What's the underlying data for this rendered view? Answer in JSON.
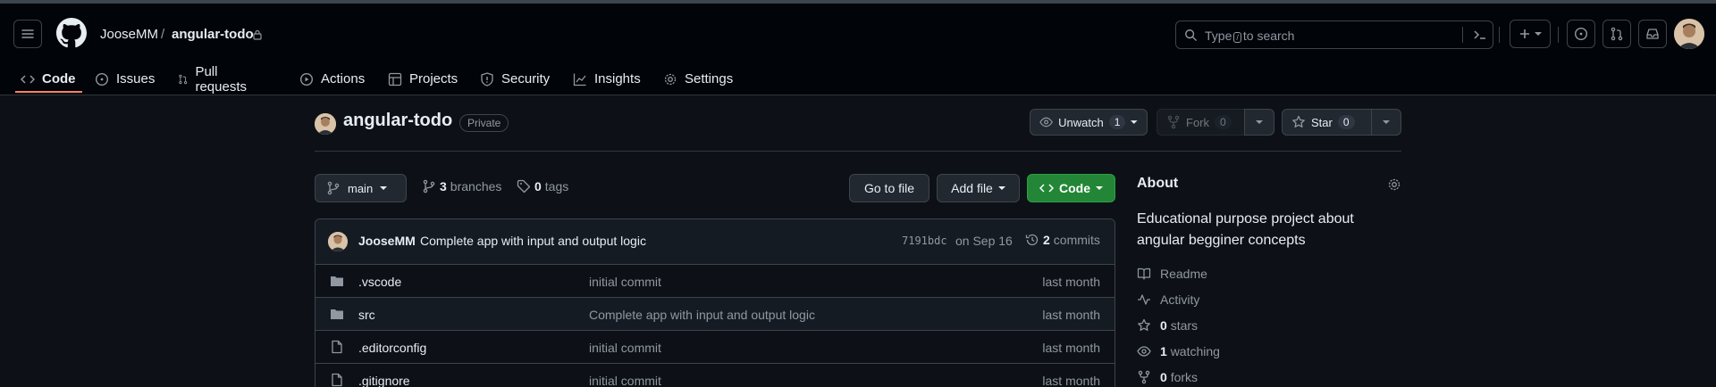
{
  "header": {
    "owner": "JooseMM",
    "separator": "/",
    "repo": "angular-todo",
    "search_placeholder_pre": "Type",
    "search_key": "/",
    "search_placeholder_post": "to search"
  },
  "tabs": [
    {
      "label": "Code"
    },
    {
      "label": "Issues"
    },
    {
      "label": "Pull requests"
    },
    {
      "label": "Actions"
    },
    {
      "label": "Projects"
    },
    {
      "label": "Security"
    },
    {
      "label": "Insights"
    },
    {
      "label": "Settings"
    }
  ],
  "repo_header": {
    "name": "angular-todo",
    "visibility": "Private",
    "unwatch_label": "Unwatch",
    "unwatch_count": "1",
    "fork_label": "Fork",
    "fork_count": "0",
    "star_label": "Star",
    "star_count": "0"
  },
  "toolbar": {
    "branch": "main",
    "branches_count": "3",
    "branches_label": "branches",
    "tags_count": "0",
    "tags_label": "tags",
    "go_to_file": "Go to file",
    "add_file": "Add file",
    "code": "Code"
  },
  "commit": {
    "author": "JooseMM",
    "message": "Complete app with input and output logic",
    "hash": "7191bdc",
    "date": "on Sep 16",
    "commits_count": "2",
    "commits_label": "commits"
  },
  "files": [
    {
      "name": ".vscode",
      "type": "folder",
      "message": "initial commit",
      "time": "last month"
    },
    {
      "name": "src",
      "type": "folder",
      "message": "Complete app with input and output logic",
      "time": "last month"
    },
    {
      "name": ".editorconfig",
      "type": "file",
      "message": "initial commit",
      "time": "last month"
    },
    {
      "name": ".gitignore",
      "type": "file",
      "message": "initial commit",
      "time": "last month"
    }
  ],
  "about": {
    "title": "About",
    "description": "Educational purpose project about angular begginer concepts",
    "readme": "Readme",
    "activity": "Activity",
    "stars_count": "0",
    "stars_label": "stars",
    "watching_count": "1",
    "watching_label": "watching",
    "forks_count": "0",
    "forks_label": "forks"
  },
  "colors": {
    "accent_underline": "#f78166",
    "code_button": "#238636",
    "background": "#0d1117",
    "header_background": "#010409"
  }
}
